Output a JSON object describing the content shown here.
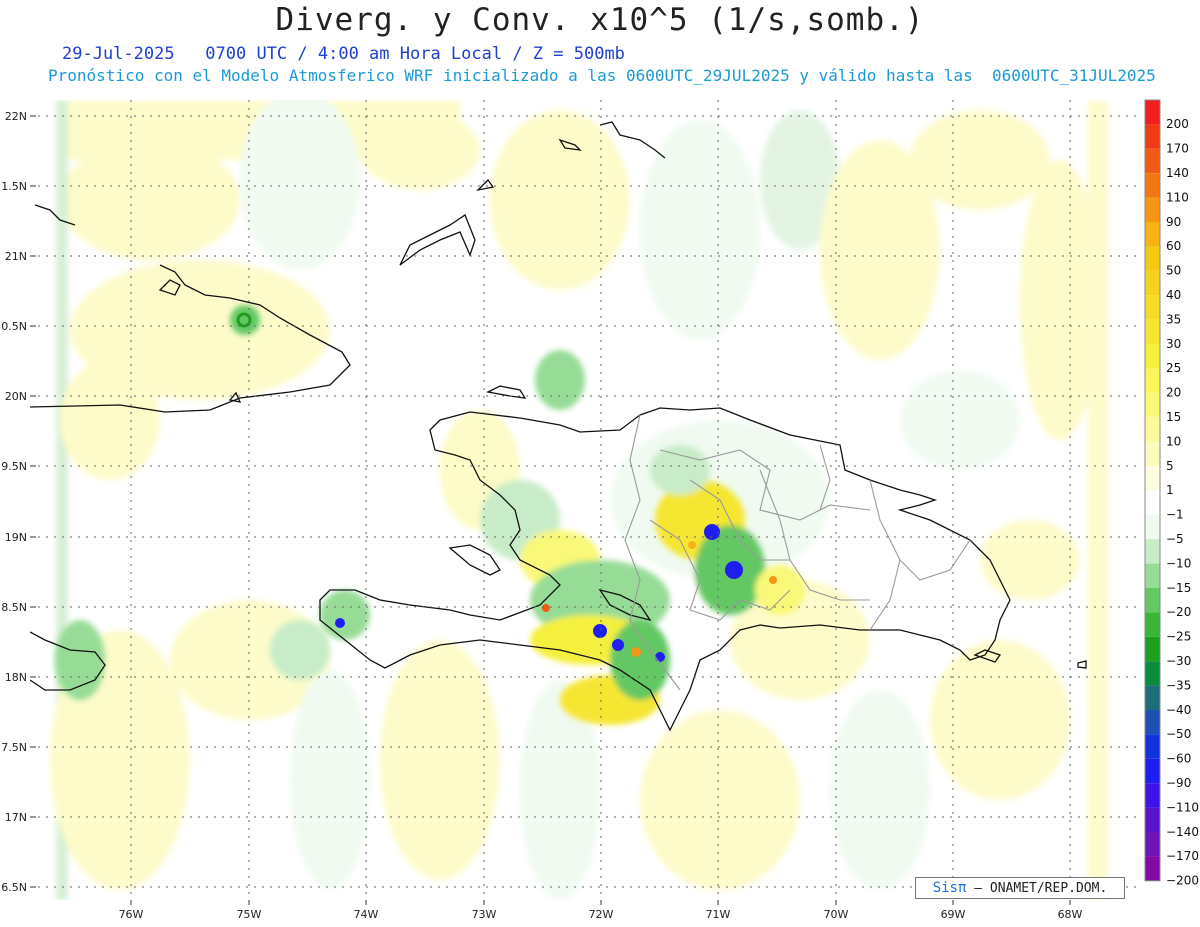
{
  "header": {
    "title": "Diverg. y Conv. x10^5 (1/s,somb.)",
    "subtitle_time": "29-Jul-2025   0700 UTC / 4:00 am Hora Local / Z = 500mb",
    "subtitle_model": "Pronóstico con el Modelo Atmosferico WRF inicializado a las 0600UTC_29JUL2025 y válido hasta las  0600UTC_31JUL2025"
  },
  "map": {
    "lat_labels": [
      "22N",
      "1.5N",
      "21N",
      "0.5N",
      "20N",
      "9.5N",
      "19N",
      "8.5N",
      "18N",
      "7.5N",
      "17N",
      "6.5N"
    ],
    "lon_labels": [
      "76W",
      "75W",
      "74W",
      "73W",
      "72W",
      "71W",
      "70W",
      "69W",
      "68W"
    ]
  },
  "colorbar": {
    "levels": [
      "200",
      "170",
      "140",
      "110",
      "90",
      "60",
      "50",
      "40",
      "35",
      "30",
      "25",
      "20",
      "15",
      "10",
      "5",
      "1",
      "−1",
      "−5",
      "−10",
      "−15",
      "−20",
      "−25",
      "−30",
      "−35",
      "−40",
      "−50",
      "−60",
      "−90",
      "−110",
      "−140",
      "−170",
      "−200"
    ],
    "colors": [
      "#f01e1e",
      "#f03c14",
      "#f05a14",
      "#f07814",
      "#f59614",
      "#f5b414",
      "#f5c814",
      "#f5d21e",
      "#f5dc28",
      "#f5e632",
      "#f5f03c",
      "#faf55a",
      "#faf878",
      "#fbfa9a",
      "#fcfbbe",
      "#fdfde2",
      "#ffffff",
      "#f0faf0",
      "#c8ecc8",
      "#96dc96",
      "#64c864",
      "#3cb43c",
      "#1ea01e",
      "#0a8c3c",
      "#1e6e78",
      "#1e50b4",
      "#1432dc",
      "#1e1ef0",
      "#3c14e6",
      "#5a14c8",
      "#6e14b4",
      "#820aa0"
    ]
  },
  "credit": {
    "sis": "Sisπ",
    "text": "– ONAMET/REP.DOM."
  }
}
